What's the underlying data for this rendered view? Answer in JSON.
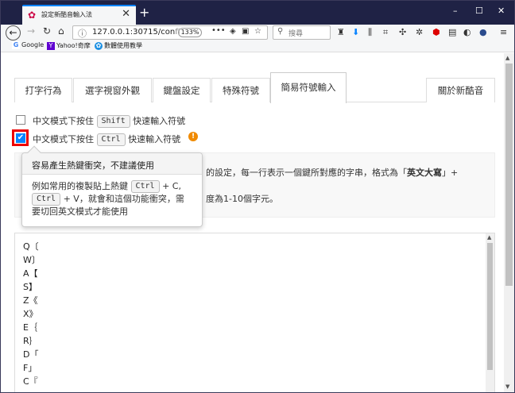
{
  "browser": {
    "tab_title": "設定新酷音輸入法",
    "tab_close": "✕",
    "new_tab": "+",
    "window_controls": {
      "minimize": "–",
      "maximize": "☐",
      "close": "✕"
    },
    "url": "127.0.0.1:30715/con",
    "url_faded": "fi",
    "zoom": "133%",
    "more": "•••",
    "search_placeholder": "搜尋",
    "bookmarks": [
      {
        "label": "Google",
        "icon": "G",
        "color": "#4285f4"
      },
      {
        "label": "Yahoo!奇摩",
        "icon": "Y",
        "color": "#5f01d1"
      },
      {
        "label": "數體使用教學",
        "icon": "✿",
        "color": "#1a8fe3"
      }
    ]
  },
  "settings": {
    "tabs": [
      "打字行為",
      "選字視窗外觀",
      "鍵盤設定",
      "特殊符號",
      "簡易符號輸入",
      "關於新酷音"
    ],
    "active_tab": "簡易符號輸入",
    "option_shift": {
      "prefix": "中文模式下按住",
      "key": "Shift",
      "suffix": "快速輸入符號"
    },
    "option_ctrl": {
      "prefix": "中文模式下按住",
      "key": "Ctrl",
      "suffix": "快速輸入符號"
    },
    "warn_icon": "!",
    "description_1": "的設定，每一行表示一個鍵所對應的字串，格式為「",
    "description_bold": "英文大寫",
    "description_1_end": "」+",
    "description_2": "度為1-10個字元。",
    "tooltip": {
      "header": "容易產生熱鍵衝突，不建議使用",
      "body_1": "例如常用的複製貼上熱鍵",
      "key_1": "Ctrl",
      "body_2": "+ C,",
      "key_2": "Ctrl",
      "body_3": "+ V，就會和這個功能衝突，需",
      "body_4": "要切回英文模式才能使用"
    },
    "symbol_lines": [
      "Q〔",
      "W〕",
      "A【",
      "S】",
      "Z《",
      "X》",
      "E｛",
      "R｝",
      "D「",
      "F」",
      "C『"
    ]
  }
}
